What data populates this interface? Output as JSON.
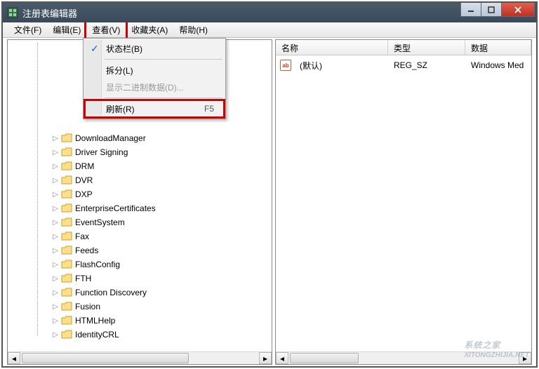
{
  "window": {
    "title": "注册表编辑器"
  },
  "menubar": {
    "items": [
      {
        "label": "文件(F)"
      },
      {
        "label": "编辑(E)"
      },
      {
        "label": "查看(V)"
      },
      {
        "label": "收藏夹(A)"
      },
      {
        "label": "帮助(H)"
      }
    ]
  },
  "view_menu": {
    "status_bar": "状态栏(B)",
    "split": "拆分(L)",
    "display_binary": "显示二进制数据(D)...",
    "refresh": "刷新(R)",
    "refresh_shortcut": "F5"
  },
  "tree": {
    "items": [
      "DownloadManager",
      "Driver Signing",
      "DRM",
      "DVR",
      "DXP",
      "EnterpriseCertificates",
      "EventSystem",
      "Fax",
      "Feeds",
      "FlashConfig",
      "FTH",
      "Function Discovery",
      "Fusion",
      "HTMLHelp",
      "IdentityCRL"
    ]
  },
  "list": {
    "columns": {
      "name": "名称",
      "type": "类型",
      "data": "数据"
    },
    "rows": [
      {
        "name": "(默认)",
        "type": "REG_SZ",
        "data": "Windows Med"
      }
    ]
  },
  "watermark": {
    "big": "系统之家",
    "small": "XITONGZHIJIA.NET"
  }
}
